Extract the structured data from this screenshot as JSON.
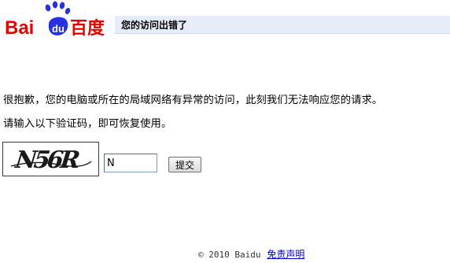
{
  "header": {
    "logo_text_latin": "Bai",
    "logo_text_du": "du",
    "logo_text_cn": "百度",
    "title": "您的访问出错了"
  },
  "message": {
    "line1": "很抱歉，您的电脑或所在的局域网络有异常的访问，此刻我们无法响应您的请求。",
    "line2": "请输入以下验证码，即可恢复使用。"
  },
  "captcha": {
    "image_text": "N56R",
    "input_value": "N",
    "submit_label": "提交"
  },
  "footer": {
    "copyright": "© 2010 Baidu",
    "disclaimer": "免责声明"
  },
  "colors": {
    "logo_red": "#e10601",
    "logo_blue": "#2932e1",
    "title_bar_bg": "#e6edf8",
    "link_blue": "#0000cc"
  }
}
